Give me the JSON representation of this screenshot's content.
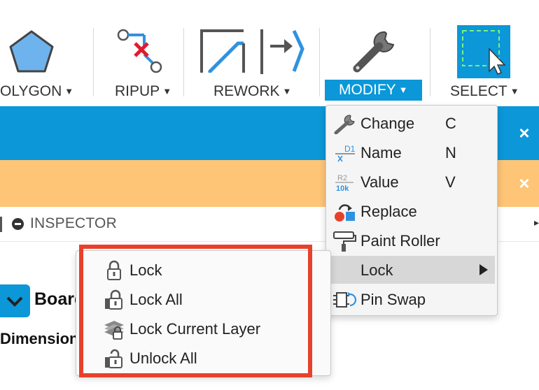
{
  "toolbar": {
    "polygon_label": "OLYGON",
    "ripup_label": "RIPUP",
    "rework_label": "REWORK",
    "modify_label": "MODIFY",
    "select_label": "SELECT",
    "caret": "▼"
  },
  "bands": {
    "close_glyph": "×"
  },
  "inspector": {
    "label": "INSPECTOR",
    "arrow": "▸"
  },
  "board": {
    "toggle_glyph": "⌄",
    "title": "Board",
    "dimensions_label": "Dimensions"
  },
  "modify_menu": {
    "items": [
      {
        "label": "Change",
        "key": "C",
        "icon": "wrench-icon"
      },
      {
        "label": "Name",
        "key": "N",
        "icon": "name-d1-icon"
      },
      {
        "label": "Value",
        "key": "V",
        "icon": "value-r2-10k-icon"
      },
      {
        "label": "Replace",
        "key": "",
        "icon": "replace-icon"
      },
      {
        "label": "Paint Roller",
        "key": "",
        "icon": "paint-roller-icon"
      },
      {
        "label": "Lock",
        "key": "",
        "icon": "",
        "has_submenu": true,
        "highlighted": true
      },
      {
        "label": "Pin Swap",
        "key": "",
        "icon": "pin-swap-icon"
      }
    ],
    "icon_text": {
      "d1": "D1",
      "r2": "R2",
      "k10": "10k"
    }
  },
  "lock_menu": {
    "items": [
      {
        "label": "Lock",
        "icon": "lock-icon"
      },
      {
        "label": "Lock All",
        "icon": "lock-all-icon"
      },
      {
        "label": "Lock Current Layer",
        "icon": "lock-layer-icon"
      },
      {
        "label": "Unlock All",
        "icon": "unlock-all-icon"
      }
    ]
  },
  "colors": {
    "accent": "#0b97d8",
    "orange_band": "#fec576",
    "highlight": "#e8412b",
    "menu_bg": "#f5f5f5"
  }
}
